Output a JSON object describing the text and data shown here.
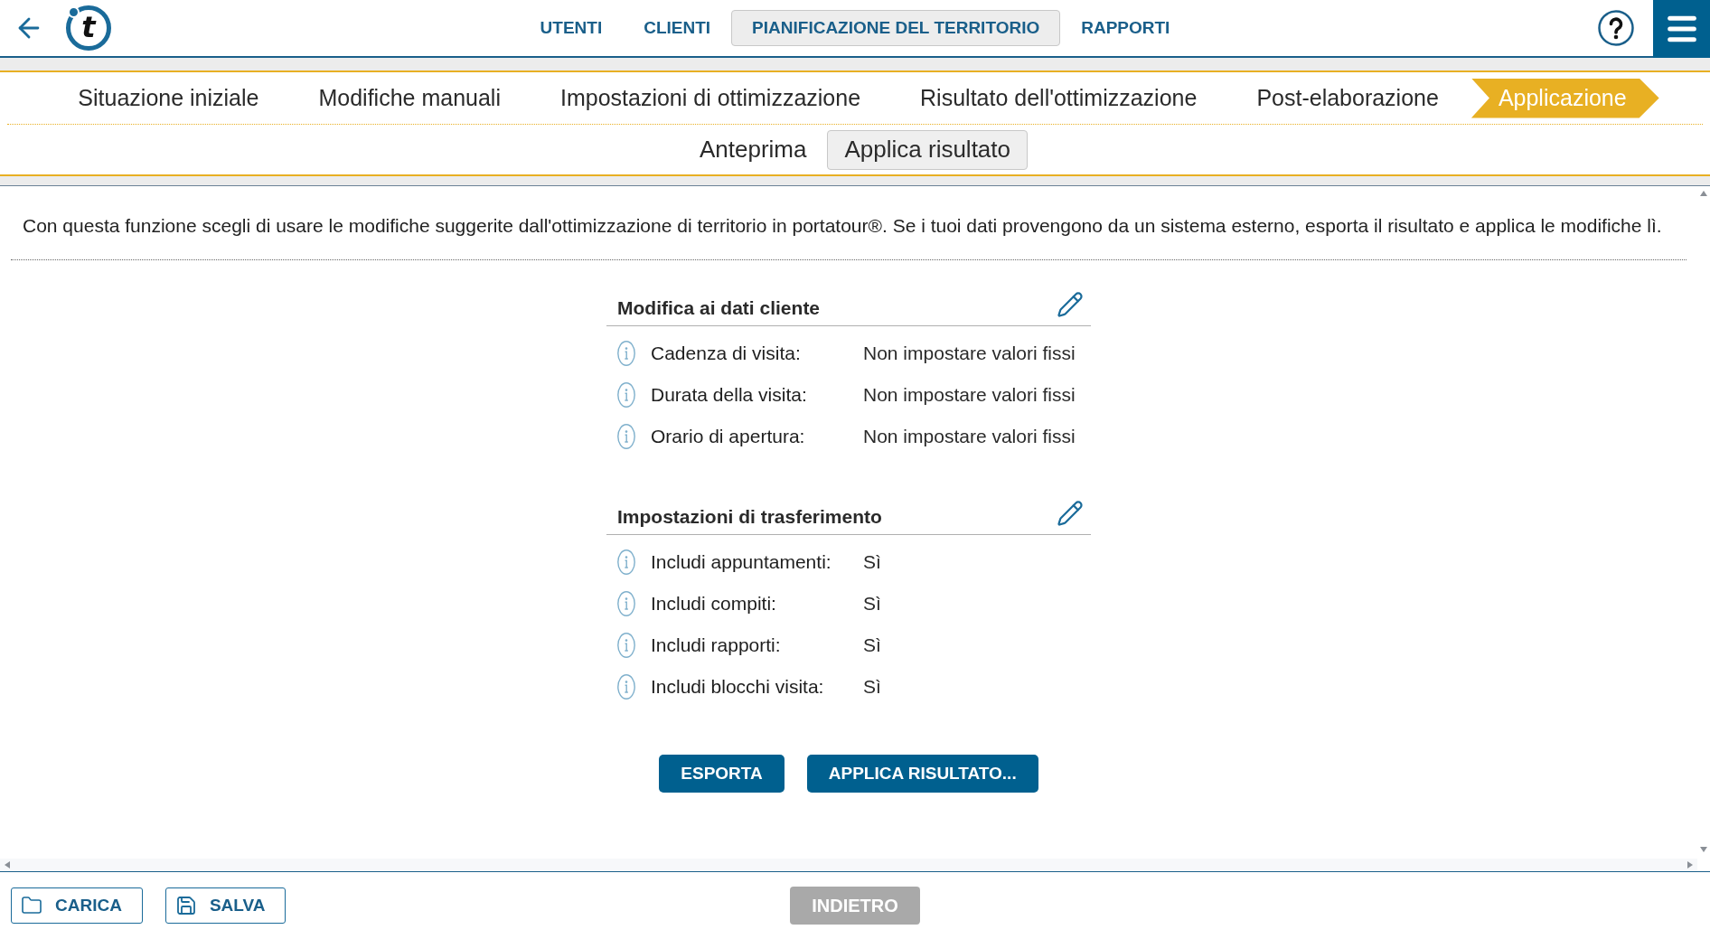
{
  "header": {
    "logo": "t",
    "nav": [
      {
        "label": "UTENTI",
        "selected": false
      },
      {
        "label": "CLIENTI",
        "selected": false
      },
      {
        "label": "PIANIFICAZIONE DEL TERRITORIO",
        "selected": true
      },
      {
        "label": "RAPPORTI",
        "selected": false
      }
    ]
  },
  "steps": [
    {
      "label": "Situazione iniziale",
      "selected": false
    },
    {
      "label": "Modifiche manuali",
      "selected": false
    },
    {
      "label": "Impostazioni di ottimizzazione",
      "selected": false
    },
    {
      "label": "Risultato dell'ottimizzazione",
      "selected": false
    },
    {
      "label": "Post-elaborazione",
      "selected": false
    },
    {
      "label": "Applicazione",
      "selected": true
    }
  ],
  "sub_tabs": [
    {
      "label": "Anteprima",
      "selected": false
    },
    {
      "label": "Applica risultato",
      "selected": true
    }
  ],
  "description": "Con questa funzione scegli di usare le modifiche suggerite dall'ottimizzazione di territorio in portatour®. Se i tuoi dati provengono da un sistema esterno, esporta il risultato e applica le modifiche lì.",
  "sections": [
    {
      "title": "Modifica ai dati cliente",
      "rows": [
        {
          "label": "Cadenza di visita:",
          "value": "Non impostare valori fissi"
        },
        {
          "label": "Durata della visita:",
          "value": "Non impostare valori fissi"
        },
        {
          "label": "Orario di apertura:",
          "value": "Non impostare valori fissi"
        }
      ]
    },
    {
      "title": "Impostazioni di trasferimento",
      "rows": [
        {
          "label": "Includi appuntamenti:",
          "value": "Sì"
        },
        {
          "label": "Includi compiti:",
          "value": "Sì"
        },
        {
          "label": "Includi rapporti:",
          "value": "Sì"
        },
        {
          "label": "Includi blocchi visita:",
          "value": "Sì"
        }
      ]
    }
  ],
  "actions": [
    "ESPORTA",
    "APPLICA RISULTATO..."
  ],
  "footer": {
    "buttons": [
      {
        "label": "CARICA",
        "kind": "load"
      },
      {
        "label": "SALVA",
        "kind": "save"
      }
    ],
    "back": {
      "label": "INDIETRO",
      "disabled": true
    }
  }
}
